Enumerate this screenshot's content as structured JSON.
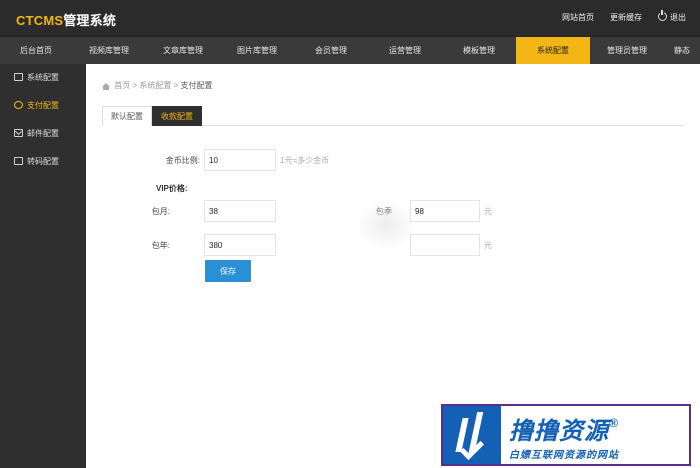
{
  "header": {
    "logo_prefix": "CTCMS",
    "logo_suffix": "管理系统",
    "links": {
      "site_home": "网站首页",
      "clear_cache": "更新缓存",
      "logout": "退出"
    }
  },
  "nav": {
    "items": [
      "后台首页",
      "视频库管理",
      "文章库管理",
      "图片库管理",
      "会员管理",
      "运营管理",
      "模板管理",
      "系统配置",
      "管理员管理",
      "静态"
    ]
  },
  "sidebar": {
    "items": [
      "系统配置",
      "支付配置",
      "邮件配置",
      "转码配置"
    ]
  },
  "breadcrumb": {
    "home": "首页",
    "sep": ">",
    "level1": "系统配置",
    "current": "支付配置"
  },
  "tabs": [
    "默认配置",
    "收款配置"
  ],
  "form": {
    "coin_ratio_label": "金币比例:",
    "coin_ratio_value": "10",
    "coin_ratio_hint": "1元=多少金币",
    "vip_title": "VIP价格:",
    "monthly_label": "包月:",
    "monthly_value": "38",
    "quarterly_label": "包季",
    "quarterly_value": "98",
    "quarterly_unit": "元",
    "yearly_label": "包年:",
    "yearly_value": "380",
    "halfyear_value": "",
    "halfyear_unit": "元",
    "save_label": "保存"
  },
  "watermark": {
    "title": "撸撸资源",
    "reg_mark": "®",
    "subtitle": "白嫖互联网资源的网站"
  },
  "colors": {
    "accent": "#f3b616",
    "button": "#2a8fd4",
    "watermark": "#1460b4"
  }
}
